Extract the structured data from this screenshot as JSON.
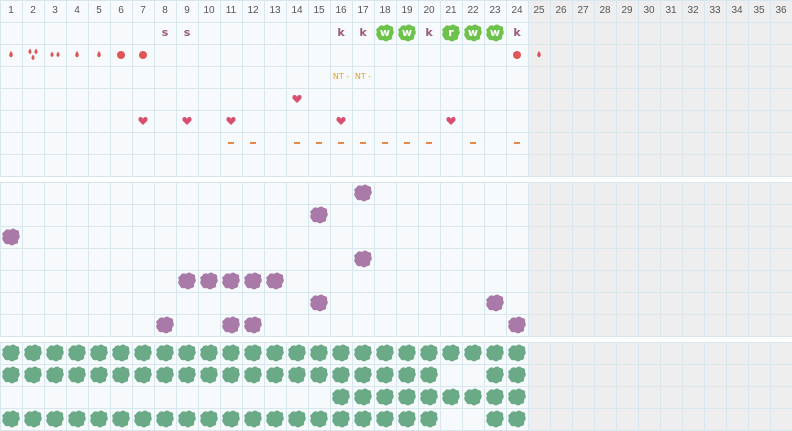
{
  "calendar": {
    "days": [
      "1",
      "2",
      "3",
      "4",
      "5",
      "6",
      "7",
      "8",
      "9",
      "10",
      "11",
      "12",
      "13",
      "14",
      "15",
      "16",
      "17",
      "18",
      "19",
      "20",
      "21",
      "22",
      "23",
      "24",
      "25",
      "26",
      "27",
      "28",
      "29",
      "30",
      "31",
      "32",
      "33",
      "34",
      "35",
      "36"
    ],
    "active_days": 24
  },
  "colors": {
    "grid_line": "#d8e6ee",
    "cell_bg": "#f6fafc",
    "inactive_bg": "#eeeeee",
    "header_text": "#555555",
    "drop": "#e05555",
    "heart": "#d94f70",
    "dash": "#e8884a",
    "nt": "#e2a02a",
    "letter": "#9a5a7a",
    "green_badge": "#6cc24a",
    "purple_blob": "#a97aa8",
    "teal_blob": "#6aaa86"
  },
  "marks": {
    "letters": [
      {
        "col": 8,
        "row": 1,
        "text": "s"
      },
      {
        "col": 9,
        "row": 1,
        "text": "s"
      },
      {
        "col": 16,
        "row": 1,
        "text": "k"
      },
      {
        "col": 17,
        "row": 1,
        "text": "k"
      },
      {
        "col": 20,
        "row": 1,
        "text": "k"
      },
      {
        "col": 24,
        "row": 1,
        "text": "k"
      }
    ],
    "badges": [
      {
        "col": 18,
        "row": 1,
        "text": "w"
      },
      {
        "col": 19,
        "row": 1,
        "text": "w"
      },
      {
        "col": 21,
        "row": 1,
        "text": "r"
      },
      {
        "col": 22,
        "row": 1,
        "text": "w"
      },
      {
        "col": 23,
        "row": 1,
        "text": "w"
      }
    ],
    "drops": [
      {
        "col": 1,
        "row": 2,
        "kind": "single"
      },
      {
        "col": 2,
        "row": 2,
        "kind": "triple"
      },
      {
        "col": 3,
        "row": 2,
        "kind": "double"
      },
      {
        "col": 4,
        "row": 2,
        "kind": "single"
      },
      {
        "col": 5,
        "row": 2,
        "kind": "single"
      },
      {
        "col": 6,
        "row": 2,
        "kind": "dot"
      },
      {
        "col": 7,
        "row": 2,
        "kind": "dot"
      },
      {
        "col": 24,
        "row": 2,
        "kind": "dot"
      },
      {
        "col": 25,
        "row": 2,
        "kind": "single"
      }
    ],
    "nt": [
      {
        "col": 16,
        "row": 3,
        "text": "NT -"
      },
      {
        "col": 17,
        "row": 3,
        "text": "NT -"
      }
    ],
    "hearts": [
      {
        "col": 14,
        "row": 4
      },
      {
        "col": 7,
        "row": 5
      },
      {
        "col": 9,
        "row": 5
      },
      {
        "col": 11,
        "row": 5
      },
      {
        "col": 16,
        "row": 5
      },
      {
        "col": 21,
        "row": 5
      }
    ],
    "dashes": [
      11,
      12,
      14,
      15,
      16,
      17,
      18,
      19,
      20,
      22,
      24
    ],
    "purple_blobs": [
      {
        "col": 17,
        "row": 9
      },
      {
        "col": 15,
        "row": 10
      },
      {
        "col": 1,
        "row": 11
      },
      {
        "col": 17,
        "row": 12
      },
      {
        "col": 9,
        "row": 13
      },
      {
        "col": 10,
        "row": 13
      },
      {
        "col": 11,
        "row": 13
      },
      {
        "col": 12,
        "row": 13
      },
      {
        "col": 13,
        "row": 13
      },
      {
        "col": 15,
        "row": 14
      },
      {
        "col": 23,
        "row": 14
      },
      {
        "col": 8,
        "row": 15
      },
      {
        "col": 11,
        "row": 15
      },
      {
        "col": 12,
        "row": 15
      },
      {
        "col": 24,
        "row": 15
      }
    ],
    "teal_rows": [
      {
        "row": 16,
        "cols": [
          1,
          2,
          3,
          4,
          5,
          6,
          7,
          8,
          9,
          10,
          11,
          12,
          13,
          14,
          15,
          16,
          17,
          18,
          19,
          20,
          21,
          22,
          23,
          24
        ]
      },
      {
        "row": 17,
        "cols": [
          1,
          2,
          3,
          4,
          5,
          6,
          7,
          8,
          9,
          10,
          11,
          12,
          13,
          14,
          15,
          16,
          17,
          18,
          19,
          20,
          23,
          24
        ]
      },
      {
        "row": 18,
        "cols": [
          16,
          17,
          18,
          19,
          20,
          21,
          22,
          23,
          24
        ]
      },
      {
        "row": 19,
        "cols": [
          1,
          2,
          3,
          4,
          5,
          6,
          7,
          8,
          9,
          10,
          11,
          12,
          13,
          14,
          15,
          16,
          17,
          18,
          19,
          20,
          23,
          24
        ]
      }
    ]
  }
}
